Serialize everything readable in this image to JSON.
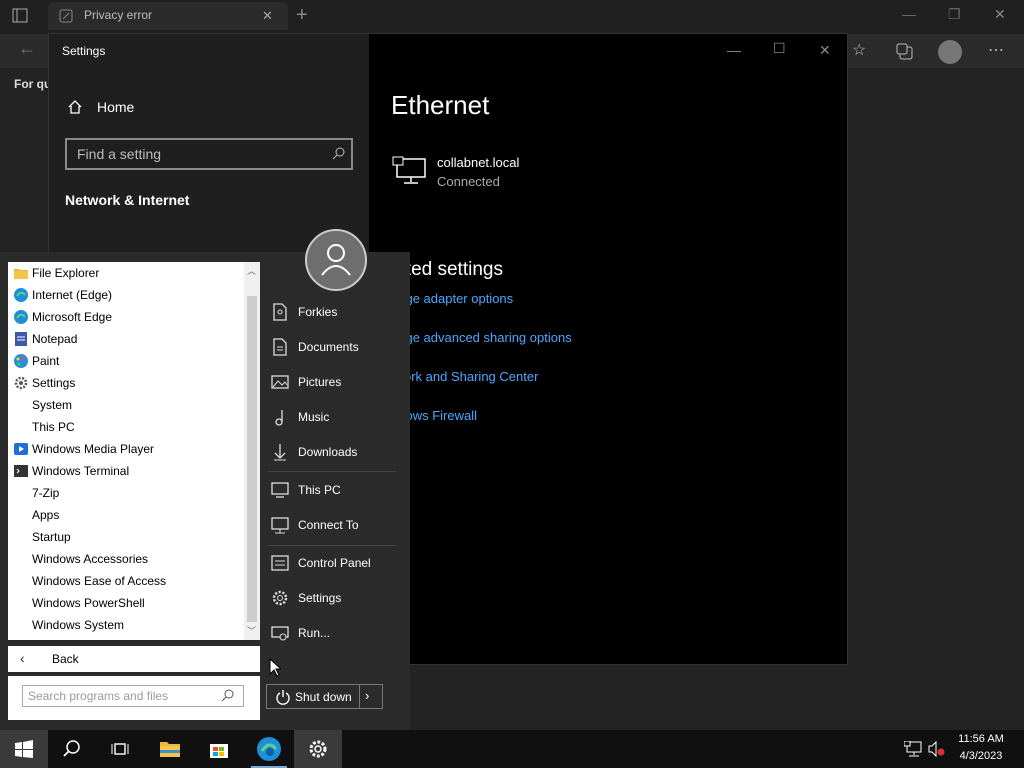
{
  "browser": {
    "tab_title": "Privacy error",
    "content_snippet": "For qu"
  },
  "settings": {
    "window_title": "Settings",
    "home_label": "Home",
    "search_placeholder": "Find a setting",
    "section": "Network & Internet",
    "page_title": "Ethernet",
    "network_name": "collabnet.local",
    "network_status": "Connected",
    "related_title": "lated settings",
    "links": [
      "ange adapter options",
      "ange advanced sharing options",
      "twork and Sharing Center",
      "ndows Firewall"
    ]
  },
  "start_menu": {
    "programs": [
      {
        "label": "File Explorer",
        "icon": "folder-icon"
      },
      {
        "label": "Internet (Edge)",
        "icon": "edge-icon"
      },
      {
        "label": "Microsoft Edge",
        "icon": "edge-icon"
      },
      {
        "label": "Notepad",
        "icon": "notepad-icon"
      },
      {
        "label": "Paint",
        "icon": "paint-icon"
      },
      {
        "label": "Settings",
        "icon": "gear-icon"
      },
      {
        "label": "System",
        "icon": ""
      },
      {
        "label": "This PC",
        "icon": ""
      },
      {
        "label": "Windows Media Player",
        "icon": "media-player-icon"
      },
      {
        "label": "Windows Terminal",
        "icon": "terminal-icon"
      },
      {
        "label": "7-Zip",
        "icon": ""
      },
      {
        "label": "Apps",
        "icon": ""
      },
      {
        "label": "Startup",
        "icon": ""
      },
      {
        "label": "Windows Accessories",
        "icon": ""
      },
      {
        "label": "Windows Ease of Access",
        "icon": ""
      },
      {
        "label": "Windows PowerShell",
        "icon": ""
      },
      {
        "label": "Windows System",
        "icon": ""
      }
    ],
    "back_label": "Back",
    "search_placeholder": "Search programs and files",
    "places": [
      {
        "label": "Forkies",
        "icon": "user-folder-icon"
      },
      {
        "label": "Documents",
        "icon": "document-icon"
      },
      {
        "label": "Pictures",
        "icon": "picture-icon"
      },
      {
        "label": "Music",
        "icon": "music-icon"
      },
      {
        "label": "Downloads",
        "icon": "download-icon"
      },
      {
        "label": "This PC",
        "icon": "computer-icon"
      },
      {
        "label": "Connect To",
        "icon": "connect-icon"
      },
      {
        "label": "Control Panel",
        "icon": "control-panel-icon"
      },
      {
        "label": "Settings",
        "icon": "gear-icon"
      },
      {
        "label": "Run...",
        "icon": "run-icon"
      }
    ],
    "shutdown_label": "Shut down"
  },
  "taskbar": {
    "time": "11:56 AM",
    "date": "4/3/2023"
  }
}
